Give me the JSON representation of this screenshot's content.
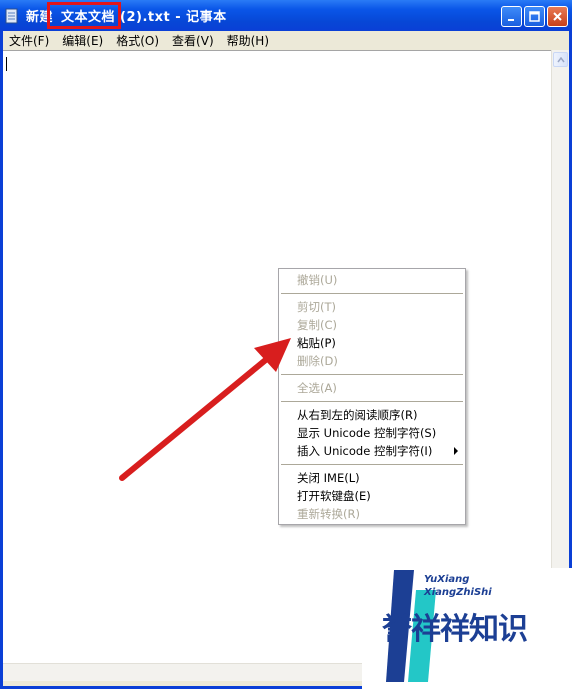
{
  "window": {
    "title_prefix": "新建",
    "title_highlight": "文本文档",
    "title_suffix": " (2).txt - 记事本"
  },
  "menubar": {
    "items": [
      {
        "label": "文件(F)"
      },
      {
        "label": "编辑(E)"
      },
      {
        "label": "格式(O)"
      },
      {
        "label": "查看(V)"
      },
      {
        "label": "帮助(H)"
      }
    ]
  },
  "context_menu": {
    "items": [
      {
        "label": "撤销(U)",
        "enabled": false
      },
      {
        "label": "剪切(T)",
        "enabled": false
      },
      {
        "label": "复制(C)",
        "enabled": false
      },
      {
        "label": "粘贴(P)",
        "enabled": true
      },
      {
        "label": "删除(D)",
        "enabled": false
      },
      {
        "label": "全选(A)",
        "enabled": false
      },
      {
        "label": "从右到左的阅读顺序(R)",
        "enabled": true
      },
      {
        "label": "显示 Unicode 控制字符(S)",
        "enabled": true
      },
      {
        "label": "插入 Unicode 控制字符(I)",
        "enabled": true,
        "submenu": true
      },
      {
        "label": "关闭 IME(L)",
        "enabled": true
      },
      {
        "label": "打开软键盘(E)",
        "enabled": true
      },
      {
        "label": "重新转换(R)",
        "enabled": false
      }
    ]
  },
  "watermark": {
    "line1": "YuXiang",
    "line2": "XiangZhiShi",
    "brand": "誉祥祥知识"
  },
  "colors": {
    "titlebar": "#0a56e8",
    "highlight_box": "#e3151a",
    "arrow": "#d81e1e",
    "disabled_text": "#aca899"
  }
}
